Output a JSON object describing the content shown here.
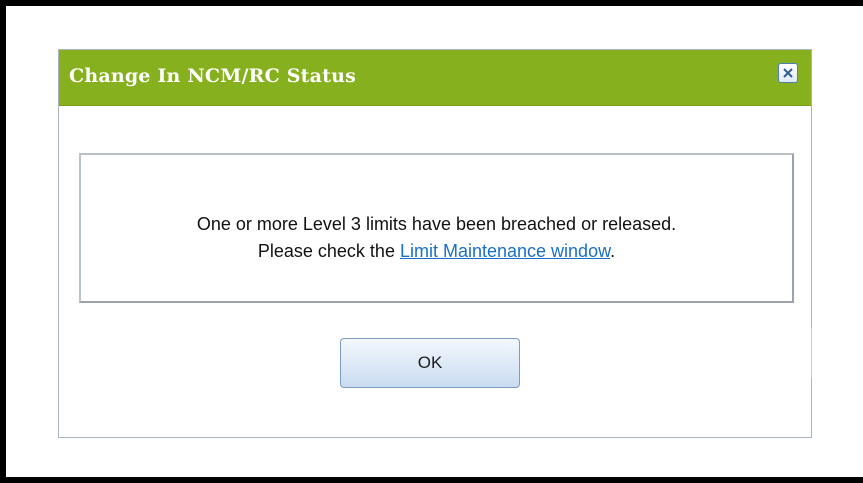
{
  "dialog": {
    "title": "Change In NCM/RC Status",
    "close_icon": "close-icon",
    "message_line1": "One or more Level 3 limits have been breached or released.",
    "message_line2_prefix": "Please check the ",
    "link_label": "Limit Maintenance window",
    "message_line2_suffix": ".",
    "ok_label": "OK"
  },
  "colors": {
    "titlebar": "#86b01e",
    "link": "#1a6fc9"
  }
}
